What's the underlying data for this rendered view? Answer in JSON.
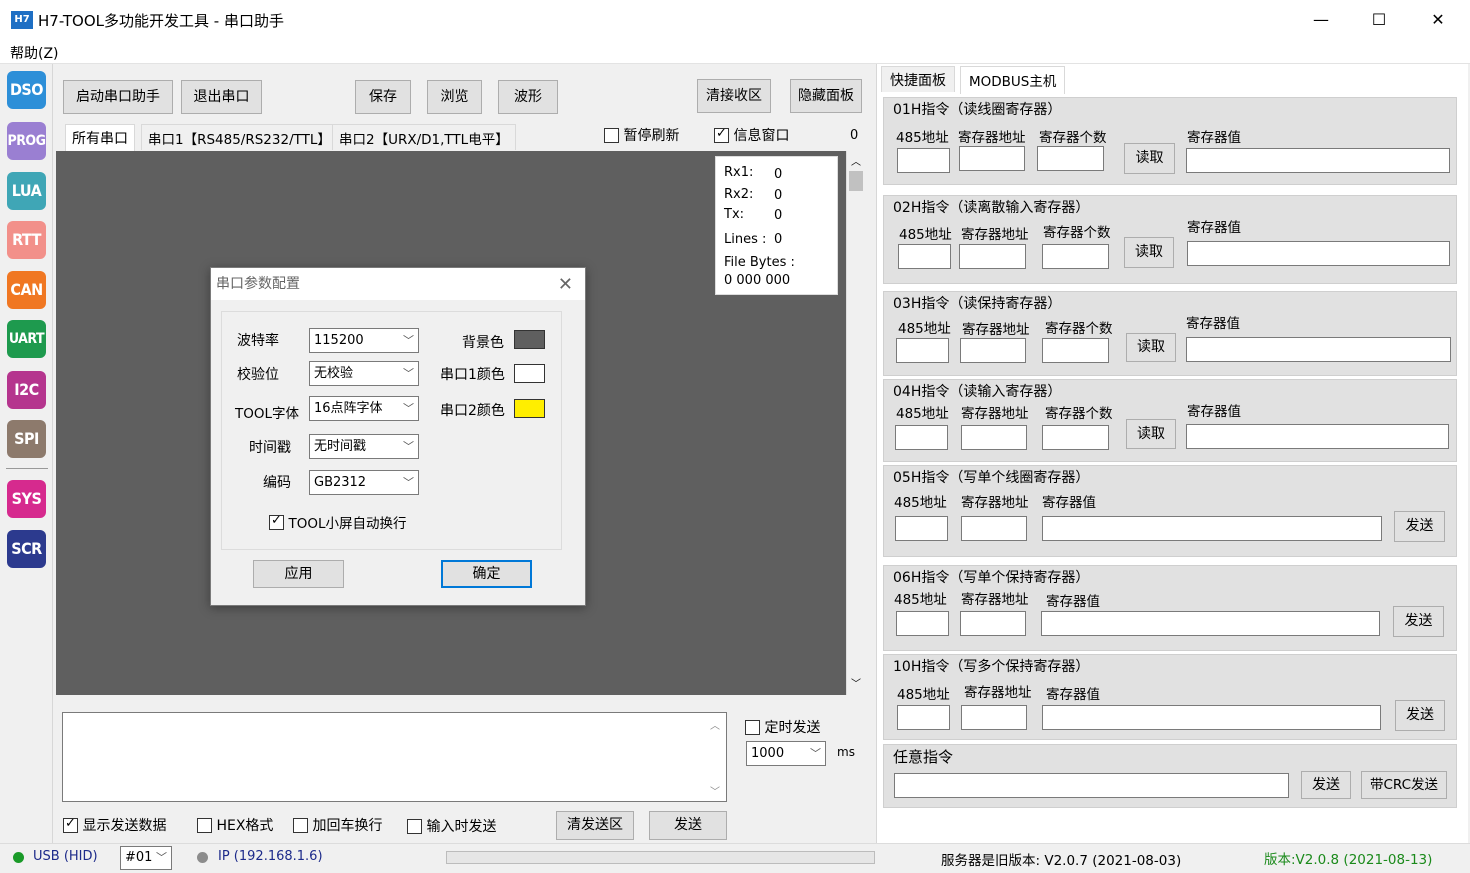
{
  "window": {
    "icon_text": "H7",
    "title": "H7-TOOL多功能开发工具 - 串口助手",
    "minimize": "—",
    "maximize": "☐",
    "close": "✕"
  },
  "menu": {
    "help": "帮助(Z)"
  },
  "sidebar": {
    "items": [
      {
        "label": "DSO",
        "color": "#2d8fd8"
      },
      {
        "label": "PROG",
        "color": "#9a7fd2"
      },
      {
        "label": "LUA",
        "color": "#3fa6b6"
      },
      {
        "label": "RTT",
        "color": "#f2908a"
      },
      {
        "label": "CAN",
        "color": "#f07722"
      },
      {
        "label": "UART",
        "color": "#1e9a4e"
      },
      {
        "label": "I2C",
        "color": "#b5358e"
      },
      {
        "label": "SPI",
        "color": "#8d7a6c"
      },
      {
        "label": "SYS",
        "color": "#d62a8e"
      },
      {
        "label": "SCR",
        "color": "#2c3a8e"
      }
    ]
  },
  "toolbar": {
    "start": "启动串口助手",
    "exit": "退出串口",
    "save": "保存",
    "browse": "浏览",
    "waveform": "波形",
    "clear_rx": "清接收区",
    "hide_panel": "隐藏面板"
  },
  "port_tabs": [
    "所有串口",
    "串口1【RS485/RS232/TTL】",
    "串口2【URX/D1,TTL电平】"
  ],
  "options": {
    "pause_refresh": "暂停刷新",
    "info_window": "信息窗口",
    "counter": "0"
  },
  "info": {
    "rx1_label": "Rx1:",
    "rx1": "0",
    "rx2_label": "Rx2:",
    "rx2": "0",
    "tx_label": "Tx:",
    "tx": "0",
    "lines_label": "Lines :",
    "lines": "0",
    "filebytes_label": "File Bytes :",
    "filebytes": "0 000 000"
  },
  "dialog": {
    "title": "串口参数配置",
    "baud_label": "波特率",
    "baud_value": "115200",
    "parity_label": "校验位",
    "parity_value": "无校验",
    "font_label": "TOOL字体",
    "font_value": "16点阵字体",
    "timestamp_label": "时间戳",
    "timestamp_value": "无时间戳",
    "encoding_label": "编码",
    "encoding_value": "GB2312",
    "bg_label": "背景色",
    "bg_color": "#5f5f5f",
    "port1_label": "串口1颜色",
    "port1_color": "#ffffff",
    "port2_label": "串口2颜色",
    "port2_color": "#ffee00",
    "autowrap_label": "TOOL小屏自动换行",
    "apply": "应用",
    "ok": "确定"
  },
  "send": {
    "timed_send": "定时发送",
    "interval": "1000",
    "unit": "ms",
    "show_send": "显示发送数据",
    "hex": "HEX格式",
    "crlf": "加回车换行",
    "send_on_input": "输入时发送",
    "clear_send": "清发送区",
    "send": "发送"
  },
  "right_tabs": [
    "快捷面板",
    "MODBUS主机"
  ],
  "modbus": {
    "g01_title": "01H指令（读线圈寄存器）",
    "g02_title": "02H指令（读离散输入寄存器）",
    "g03_title": "03H指令（读保持寄存器）",
    "g04_title": "04H指令（读输入寄存器）",
    "g05_title": "05H指令（写单个线圈寄存器）",
    "g06_title": "06H指令（写单个保持寄存器）",
    "g10_title": "10H指令（写多个保持寄存器）",
    "any_title": "任意指令",
    "addr485": "485地址",
    "reg_addr": "寄存器地址",
    "reg_count": "寄存器个数",
    "reg_value": "寄存器值",
    "read": "读取",
    "send": "发送",
    "send_crc": "带CRC发送"
  },
  "status": {
    "usb": "USB (HID)",
    "device": "#01",
    "ip": "IP (192.168.1.6)",
    "server_version": "服务器是旧版本: V2.0.7 (2021-08-03)",
    "version": "版本:V2.0.8 (2021-08-13)"
  }
}
